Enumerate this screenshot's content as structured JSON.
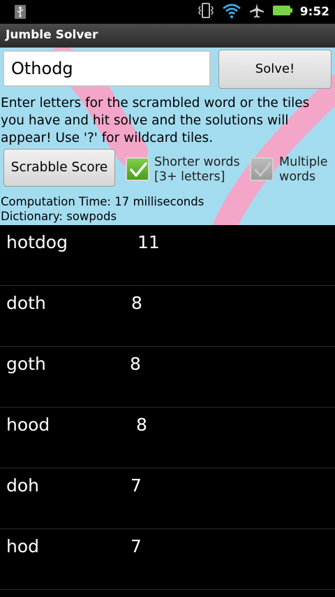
{
  "status_bar": {
    "time": "9:52",
    "icons": [
      "usb-icon",
      "vibrate-icon",
      "wifi-icon",
      "airplane-mode-icon",
      "battery-icon"
    ]
  },
  "app": {
    "title": "Jumble Solver"
  },
  "form": {
    "word_value": "Othodg",
    "solve_label": "Solve!",
    "instructions": "Enter letters for the scrambled word or the tiles you have and hit solve and the solutions will appear! Use '?' for wildcard tiles.",
    "scrabble_label": "Scrabble Score",
    "shorter_words": {
      "label": "Shorter words [3+ letters]",
      "checked": true
    },
    "multiple_words": {
      "label": "Multiple words",
      "checked": false
    },
    "computation_time": "Computation Time: 17 milliseconds",
    "dictionary": "Dictionary: sowpods"
  },
  "colors": {
    "background": "#a4dcef",
    "swoosh": "#f4a6c8",
    "checkbox_on": "#5fb52a",
    "checkbox_off": "#aaaaaa"
  },
  "results": [
    {
      "word": "hotdog",
      "score": "11"
    },
    {
      "word": "doth",
      "score": "8"
    },
    {
      "word": "goth",
      "score": "8"
    },
    {
      "word": "hood",
      "score": "8"
    },
    {
      "word": "doh",
      "score": "7"
    },
    {
      "word": "hod",
      "score": "7"
    }
  ]
}
